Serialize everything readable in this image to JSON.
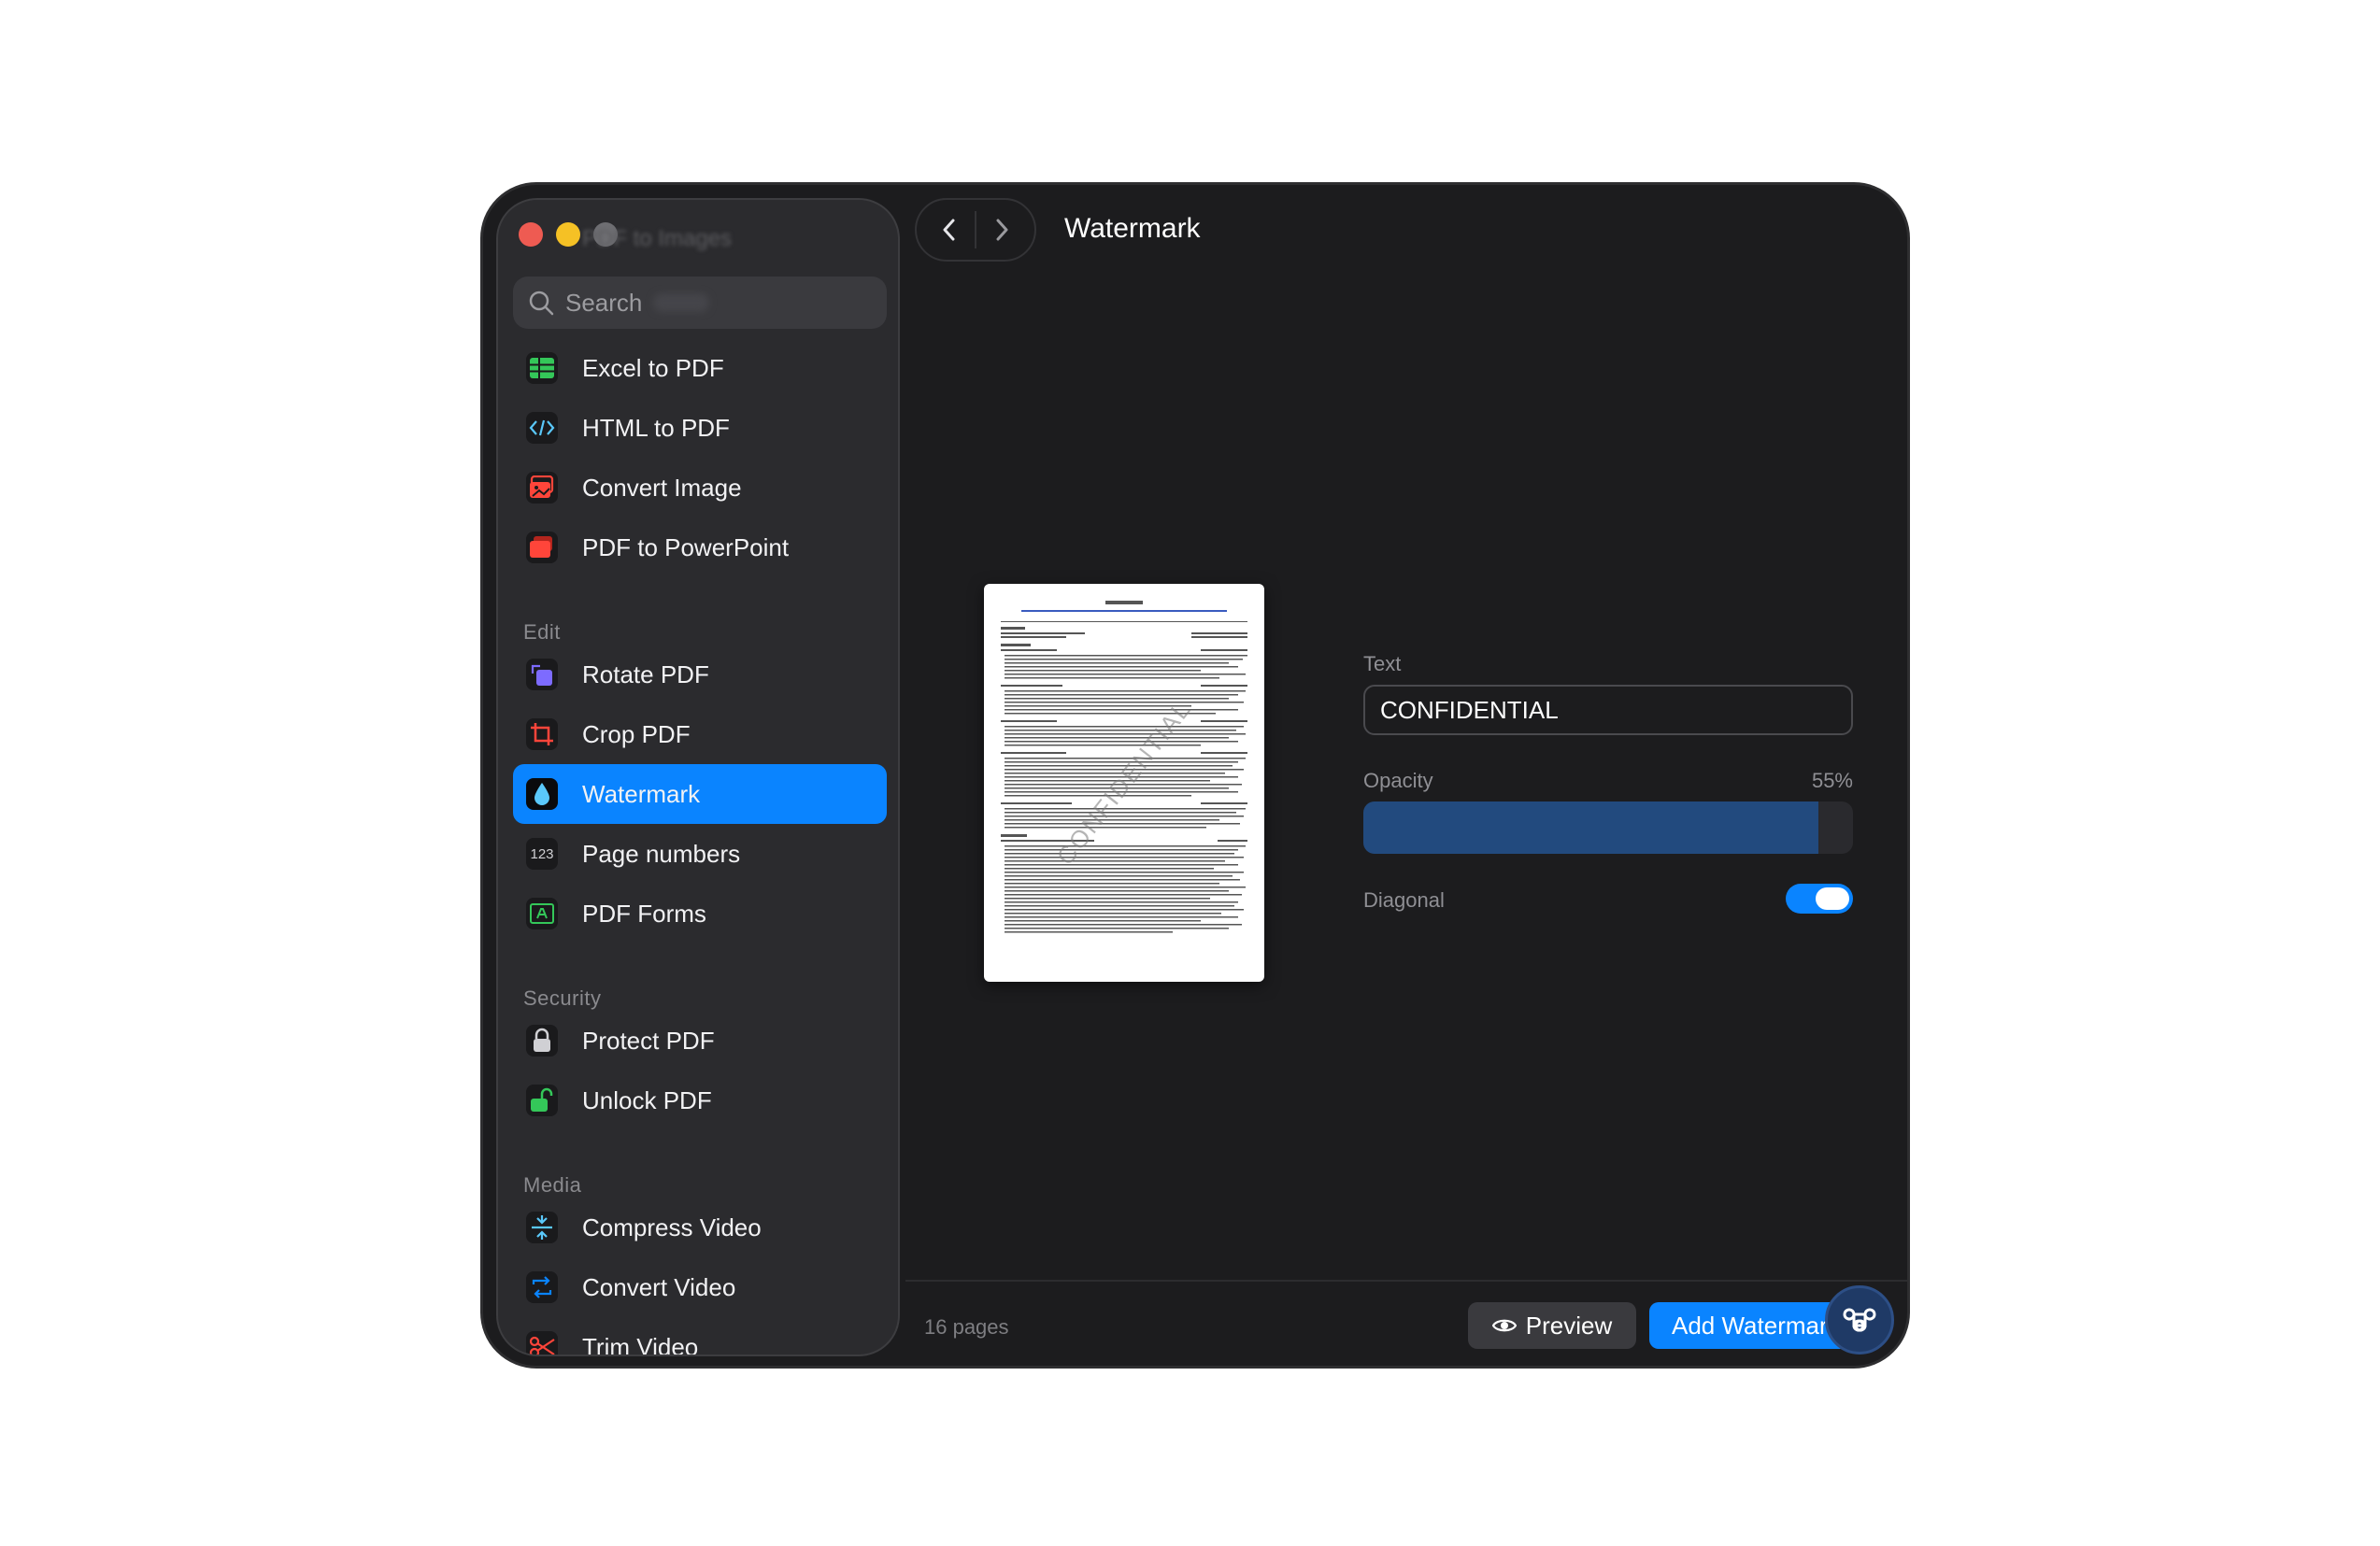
{
  "window": {
    "blurred_title": "PDF to Images"
  },
  "search": {
    "placeholder": "Search"
  },
  "sidebar": {
    "items_convert": [
      {
        "label": "Excel to PDF",
        "icon": "spreadsheet-icon",
        "color": "#34c759"
      },
      {
        "label": "HTML to PDF",
        "icon": "code-icon",
        "color": "#5ac8fa"
      },
      {
        "label": "Convert Image",
        "icon": "image-icon",
        "color": "#ff453a"
      },
      {
        "label": "PDF to PowerPoint",
        "icon": "slides-icon",
        "color": "#ff453a"
      }
    ],
    "section_edit": "Edit",
    "items_edit": [
      {
        "label": "Rotate PDF",
        "icon": "rotate-icon",
        "color": "#7d6bff"
      },
      {
        "label": "Crop PDF",
        "icon": "crop-icon",
        "color": "#ff453a"
      },
      {
        "label": "Watermark",
        "icon": "droplet-icon",
        "color": "#5ac8fa",
        "active": true
      },
      {
        "label": "Page numbers",
        "icon": "numbers-icon",
        "badge": "123"
      },
      {
        "label": "PDF Forms",
        "icon": "form-icon",
        "color": "#34c759"
      }
    ],
    "section_security": "Security",
    "items_security": [
      {
        "label": "Protect PDF",
        "icon": "lock-icon",
        "color": "#d0d0d4"
      },
      {
        "label": "Unlock PDF",
        "icon": "unlock-icon",
        "color": "#34c759"
      }
    ],
    "section_media": "Media",
    "items_media": [
      {
        "label": "Compress Video",
        "icon": "compress-icon",
        "color": "#5ac8fa"
      },
      {
        "label": "Convert Video",
        "icon": "convert-video-icon",
        "color": "#0a84ff"
      },
      {
        "label": "Trim Video",
        "icon": "scissors-icon",
        "color": "#ff453a"
      }
    ]
  },
  "header": {
    "title": "Watermark"
  },
  "document": {
    "watermark_overlay": "CONFIDENTIAL"
  },
  "controls": {
    "text_label": "Text",
    "text_value": "CONFIDENTIAL",
    "opacity_label": "Opacity",
    "opacity_value": "55%",
    "opacity_fraction": 0.93,
    "diagonal_label": "Diagonal",
    "diagonal_on": true
  },
  "footer": {
    "pages": "16 pages",
    "preview_label": "Preview",
    "add_label": "Add Watermark"
  },
  "colors": {
    "accent": "#0a84ff",
    "background": "#1c1c1e",
    "sidebar": "#2b2b2e"
  }
}
